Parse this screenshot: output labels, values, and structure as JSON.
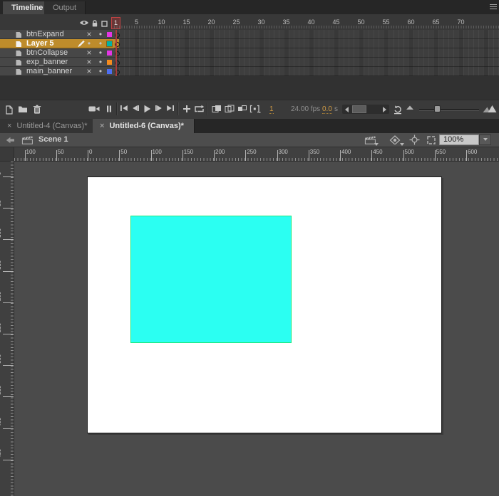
{
  "colors": {
    "selected_layer_bg": "#BE8C2B",
    "playhead_red": "#A93C3C",
    "stage_fill": "#FFFFFF",
    "stage_rect_fill": "#2BFFF2",
    "stage_rect_stroke": "#1FE87E",
    "hot_text": "#CF9A45"
  },
  "panel_tabs": [
    {
      "label": "Timeline",
      "active": true
    },
    {
      "label": "Output",
      "active": false
    }
  ],
  "panel_header_icons": [
    "visibility-icon",
    "lock-icon",
    "outline-icon"
  ],
  "timeline": {
    "frame_numbers": [
      1,
      5,
      10,
      15,
      20,
      25,
      30,
      35,
      40,
      45,
      50,
      55,
      60,
      65,
      70
    ],
    "layers": [
      {
        "name": "btnExpand",
        "visible": false,
        "locked": false,
        "outline_color": "#E435E4",
        "selected": false,
        "keyframe": "empty"
      },
      {
        "name": "Layer 5",
        "visible": true,
        "locked": false,
        "outline_color": "#00B2A5",
        "selected": true,
        "keyframe": "empty"
      },
      {
        "name": "btnCollapse",
        "visible": false,
        "locked": false,
        "outline_color": "#E435E4",
        "selected": false,
        "keyframe": "empty"
      },
      {
        "name": "exp_banner",
        "visible": false,
        "locked": false,
        "outline_color": "#F78C1E",
        "selected": false,
        "keyframe": "empty"
      },
      {
        "name": "main_banner",
        "visible": false,
        "locked": false,
        "outline_color": "#4E6FF3",
        "selected": false,
        "keyframe": "empty"
      }
    ],
    "toolbar_icons": [
      "new-layer",
      "new-folder",
      "delete-layer",
      "add-camera",
      "layer-depth",
      "go-to-first-frame",
      "step-back",
      "play",
      "step-forward",
      "go-to-last-frame",
      "center-frame",
      "loop-playback",
      "onion-skin",
      "onion-skin-outlines",
      "edit-multiple-frames",
      "modify-markers",
      "reset-timeline-zoom",
      "zoom-out-timeline",
      "zoom-in-timeline"
    ],
    "status": {
      "current_frame": "1",
      "fps": "24.00 fps",
      "elapsed": "0.0",
      "elapsed_unit": "s"
    }
  },
  "document_tabs": [
    {
      "label": "Untitled-4 (Canvas)*",
      "active": false,
      "close": "×"
    },
    {
      "label": "Untitled-6 (Canvas)*",
      "active": true,
      "close": "×"
    }
  ],
  "edit_bar": {
    "scene": "Scene 1",
    "zoom": "100%"
  },
  "rulers": {
    "horizontal": [
      "100",
      "50",
      "0",
      "50",
      "100",
      "150",
      "200",
      "250",
      "300",
      "350",
      "400",
      "450",
      "500",
      "550",
      "600"
    ],
    "vertical": [
      "0",
      "50",
      "100",
      "150",
      "200",
      "250",
      "300",
      "350",
      "400",
      "450"
    ]
  }
}
